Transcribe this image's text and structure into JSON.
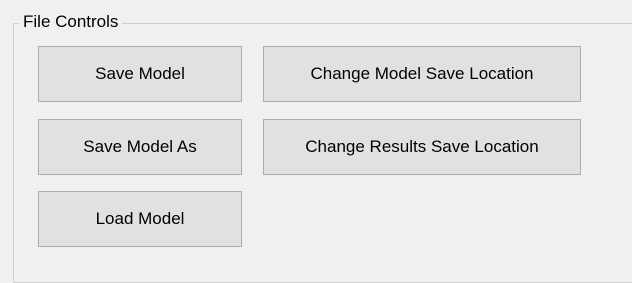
{
  "file_controls": {
    "title": "File Controls",
    "buttons": {
      "save_model": "Save Model",
      "save_model_as": "Save Model As",
      "load_model": "Load Model",
      "change_model_save_location": "Change Model Save Location",
      "change_results_save_location": "Change Results Save Location"
    }
  }
}
